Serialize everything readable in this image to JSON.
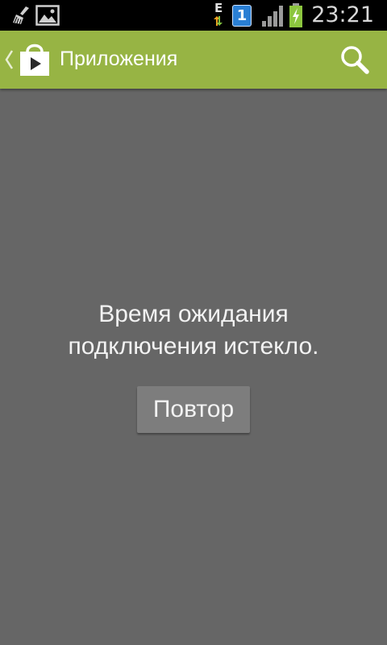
{
  "status_bar": {
    "clock": "23:21",
    "network_type": "E",
    "sim_slot": "1",
    "icons": [
      "broom-icon",
      "gallery-icon",
      "data-transfer-icon",
      "sim-icon",
      "signal-icon",
      "battery-charging-icon"
    ]
  },
  "action_bar": {
    "title": "Приложения",
    "icons": [
      "up-caret-icon",
      "play-store-icon",
      "search-icon"
    ]
  },
  "content": {
    "message_line1": "Время ожидания",
    "message_line2": "подключения истекло.",
    "retry_label": "Повтор"
  },
  "colors": {
    "action_bar": "#97b444",
    "background": "#666666",
    "status_bar": "#000000",
    "button": "#7d7d7d"
  }
}
